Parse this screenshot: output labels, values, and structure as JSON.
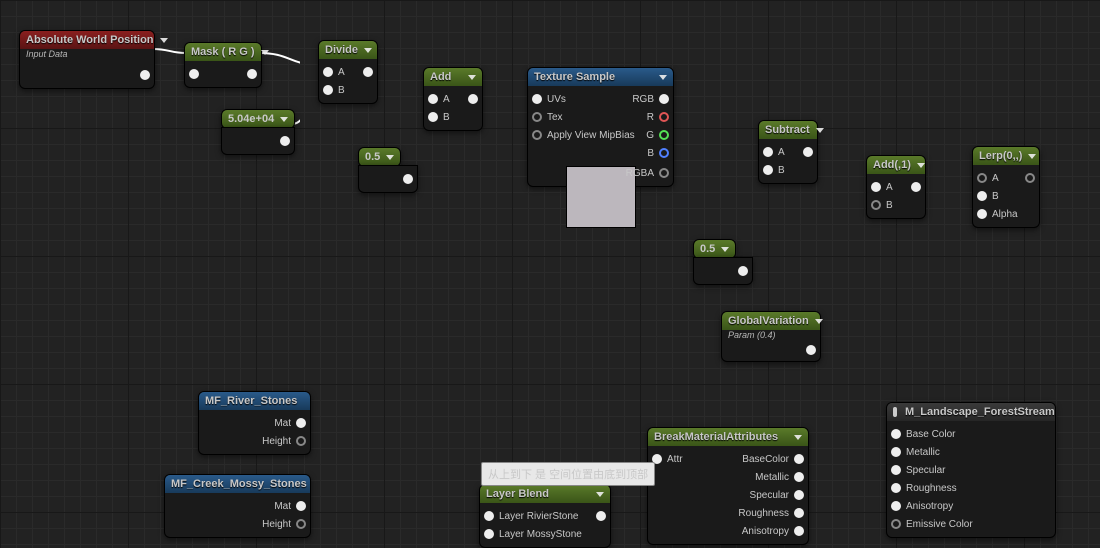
{
  "nodes": {
    "awp": {
      "title": "Absolute World Position",
      "sub": "Input Data"
    },
    "mask": {
      "title": "Mask ( R G )"
    },
    "divide": {
      "title": "Divide",
      "inA": "A",
      "inB": "B"
    },
    "add": {
      "title": "Add",
      "inA": "A",
      "inB": "B"
    },
    "tex": {
      "title": "Texture Sample",
      "uvs": "UVs",
      "texIn": "Tex",
      "mip": "Apply View MipBias",
      "rgb": "RGB",
      "r": "R",
      "g": "G",
      "b": "B",
      "rgba": "RGBA"
    },
    "sub": {
      "title": "Subtract",
      "inA": "A",
      "inB": "B"
    },
    "add1": {
      "title": "Add(,1)",
      "inA": "A",
      "inB": "B"
    },
    "lerp": {
      "title": "Lerp(0,,)",
      "inA": "A",
      "inB": "B",
      "alpha": "Alpha"
    },
    "gvar": {
      "title": "GlobalVariation",
      "sub": "Param (0.4)"
    },
    "mfRiver": {
      "title": "MF_River_Stones",
      "mat": "Mat",
      "height": "Height"
    },
    "mfCreek": {
      "title": "MF_Creek_Mossy_Stones",
      "mat": "Mat",
      "height": "Height"
    },
    "layerBlend": {
      "title": "Layer Blend",
      "l1": "Layer RivierStone",
      "l2": "Layer MossyStone"
    },
    "bma": {
      "title": "BreakMaterialAttributes",
      "attr": "Attr",
      "bc": "BaseColor",
      "met": "Metallic",
      "spec": "Specular",
      "rough": "Roughness",
      "aniso": "Anisotropy"
    },
    "mland": {
      "title": "M_Landscape_ForestStream",
      "bc": "Base Color",
      "met": "Metallic",
      "spec": "Specular",
      "rough": "Roughness",
      "aniso": "Anisotropy",
      "emis": "Emissive Color"
    }
  },
  "chips": {
    "c1": "5.04e+04",
    "c2": "0.5",
    "c3": "0.5"
  },
  "tooltip": "从上到下 是 空间位置由底到顶部"
}
